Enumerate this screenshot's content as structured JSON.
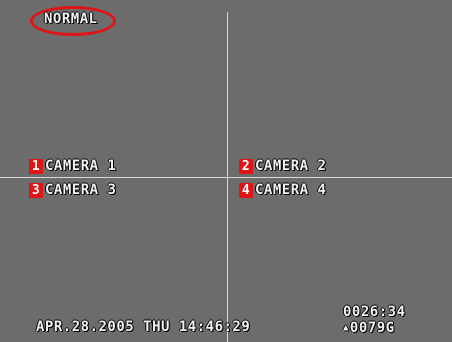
{
  "mode": {
    "label": "NORMAL"
  },
  "cameras": [
    {
      "number": "1",
      "label": "CAMERA 1"
    },
    {
      "number": "2",
      "label": "CAMERA 2"
    },
    {
      "number": "3",
      "label": "CAMERA 3"
    },
    {
      "number": "4",
      "label": "CAMERA 4"
    }
  ],
  "status": {
    "datetime": "APR.28.2005 THU 14:46:29",
    "counter": "0026:34",
    "remaining": "0079G",
    "remaining_icon": "user-icon"
  },
  "colors": {
    "highlight": "#e01414",
    "background": "#6c6c6c",
    "text": "#f2f2f2"
  }
}
